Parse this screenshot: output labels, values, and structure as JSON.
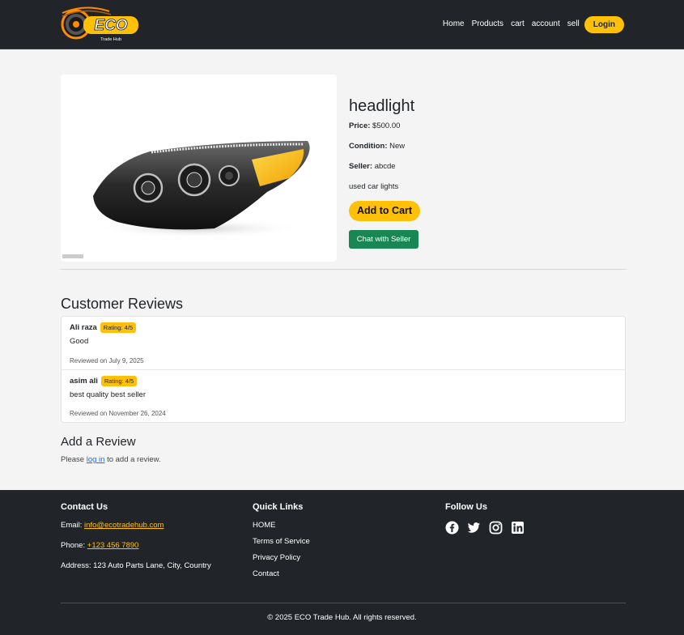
{
  "brand": {
    "logo_text": "ECO",
    "logo_subtext": "Trade Hub"
  },
  "nav": {
    "items": [
      {
        "label": "Home"
      },
      {
        "label": "Products"
      },
      {
        "label": "cart"
      },
      {
        "label": "account"
      },
      {
        "label": "sell"
      }
    ],
    "login_label": "Login"
  },
  "product": {
    "title": "headlight",
    "price_label": "Price:",
    "price": "$500.00",
    "condition_label": "Condition:",
    "condition": "New",
    "seller_label": "Seller:",
    "seller": "abcde",
    "description": "used car lights",
    "add_to_cart_label": "Add to Cart",
    "chat_label": "Chat with Seller"
  },
  "reviews": {
    "title": "Customer Reviews",
    "items": [
      {
        "name": "Ali raza",
        "rating": "Rating: 4/5",
        "text": "Good",
        "date": "Reviewed on July 9, 2025"
      },
      {
        "name": "asim ali",
        "rating": "Rating: 4/5",
        "text": "best quality best seller",
        "date": "Reviewed on November 26, 2024"
      }
    ]
  },
  "add_review": {
    "title": "Add a Review",
    "prefix": "Please",
    "link": "log in",
    "suffix": "to add a review."
  },
  "footer": {
    "contact": {
      "title": "Contact Us",
      "email_label": "Email:",
      "email": "info@ecotradehub.com",
      "phone_label": "Phone:",
      "phone": "+123 456 7890",
      "address_label": "Address:",
      "address": "123 Auto Parts Lane, City, Country"
    },
    "quick_links": {
      "title": "Quick Links",
      "items": [
        "HOME",
        "Terms of Service",
        "Privacy Policy",
        "Contact"
      ]
    },
    "follow": {
      "title": "Follow Us",
      "icons": [
        "facebook-icon",
        "twitter-icon",
        "instagram-icon",
        "linkedin-icon"
      ]
    },
    "copyright": "© 2025 ECO Trade Hub. All rights reserved."
  },
  "colors": {
    "accent": "#ffc107",
    "dark": "#212529",
    "success": "#198754",
    "link": "#0d6efd"
  }
}
